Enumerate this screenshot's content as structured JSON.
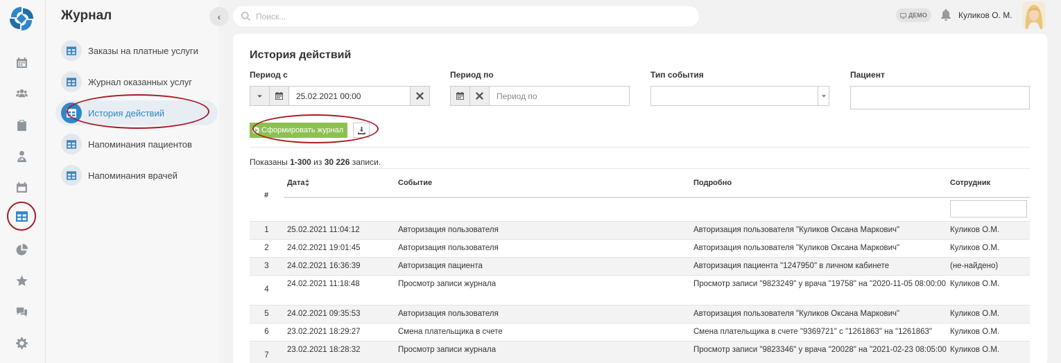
{
  "rail": {
    "icons": [
      "logo-icon",
      "calendar-icon",
      "users-icon",
      "clipboard-icon",
      "doctor-icon",
      "schedule-icon",
      "table-icon",
      "pie-chart-icon",
      "star-icon",
      "chat-icon",
      "gear-icon"
    ],
    "active": "table-icon"
  },
  "sidebar": {
    "title": "Журнал",
    "items": [
      {
        "label": "Заказы на платные услуги"
      },
      {
        "label": "Журнал оказанных услуг"
      },
      {
        "label": "История действий"
      },
      {
        "label": "Напоминания пациентов"
      },
      {
        "label": "Напоминания врачей"
      }
    ],
    "active_index": 2
  },
  "topbar": {
    "search_placeholder": "Поиск...",
    "demo_badge": "ДЕМО",
    "user_name": "Куликов О. М."
  },
  "main": {
    "title": "История действий",
    "filters": {
      "period_from_label": "Период с",
      "period_from_value": "25.02.2021 00:00",
      "period_to_label": "Период по",
      "period_to_placeholder": "Период по",
      "event_type_label": "Тип события",
      "event_type_value": "",
      "patient_label": "Пациент",
      "patient_value": ""
    },
    "generate_button": "Сформировать журнал",
    "shown_prefix": "Показаны ",
    "shown_range": "1-300",
    "shown_mid": " из ",
    "shown_total": "30 226",
    "shown_suffix": " записи.",
    "columns": {
      "num": "#",
      "date": "Дата",
      "event": "Событие",
      "details": "Подробно",
      "employee": "Сотрудник"
    },
    "rows": [
      {
        "num": "1",
        "date": "25.02.2021 11:04:12",
        "event": "Авторизация пользователя",
        "details": "Авторизация пользователя \"Куликов Оксана Маркович\"",
        "employee": "Куликов О.М."
      },
      {
        "num": "2",
        "date": "24.02.2021 19:01:45",
        "event": "Авторизация пользователя",
        "details": "Авторизация пользователя \"Куликов Оксана Маркович\"",
        "employee": "Куликов О.М."
      },
      {
        "num": "3",
        "date": "24.02.2021 16:36:39",
        "event": "Авторизация пациента",
        "details": "Авторизация пациента \"1247950\" в личном кабинете",
        "employee": "(не-найдено)"
      },
      {
        "num": "4",
        "date": "24.02.2021 11:18:48",
        "event": "Просмотр записи журнала",
        "details": "Просмотр записи \"9823249\" у врача \"19758\" на \"2020-11-05 08:00:00",
        "employee": "Куликов О.М."
      },
      {
        "num": "5",
        "date": "24.02.2021 09:35:53",
        "event": "Авторизация пользователя",
        "details": "Авторизация пользователя \"Куликов Оксана Маркович\"",
        "employee": "Куликов О.М."
      },
      {
        "num": "6",
        "date": "23.02.2021 18:29:27",
        "event": "Смена плательщика в счете",
        "details": "Смена плательщика в счете \"9369721\" с \"1261863\" на \"1261863\"",
        "employee": "Куликов О.М."
      },
      {
        "num": "7",
        "date": "23.02.2021 18:28:32",
        "event": "Просмотр записи журнала",
        "details": "Просмотр записи \"9823346\" у врача \"20028\" на \"2021-02-23 08:05:00",
        "employee": "Куликов О.М."
      }
    ]
  }
}
